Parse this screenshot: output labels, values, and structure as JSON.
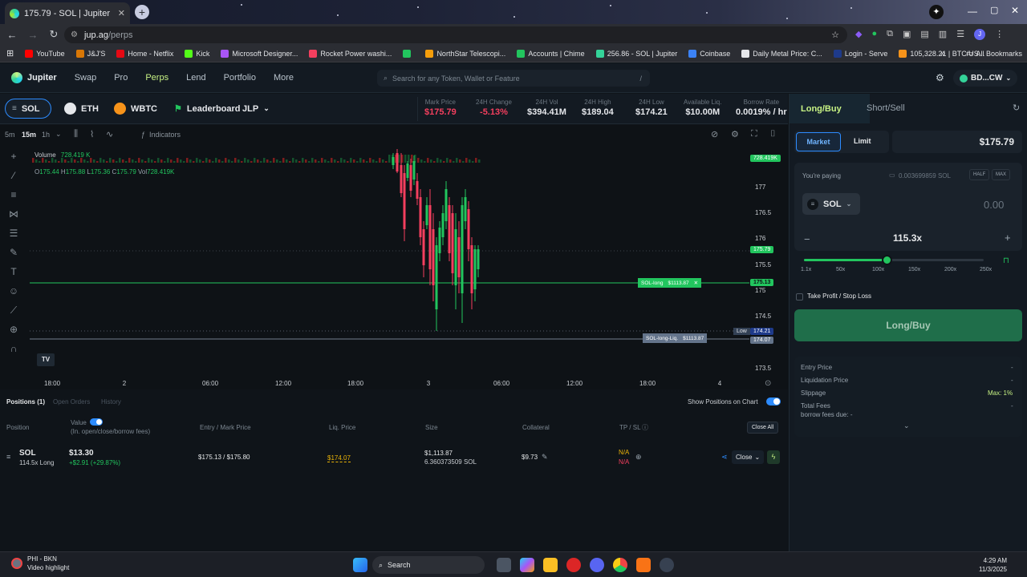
{
  "browser": {
    "tab_title": "175.79 - SOL | Jupiter",
    "url_domain": "jup.ag",
    "url_path": "/perps",
    "bookmarks": [
      {
        "label": "YouTube",
        "color": "#ff0000"
      },
      {
        "label": "J&J'S",
        "color": "#d97706"
      },
      {
        "label": "Home - Netflix",
        "color": "#e50914"
      },
      {
        "label": "Kick",
        "color": "#53fc18"
      },
      {
        "label": "Microsoft Designer...",
        "color": "#a855f7"
      },
      {
        "label": "Rocket Power washi...",
        "color": "#f43f5e"
      },
      {
        "label": "",
        "color": "#22c55e"
      },
      {
        "label": "NorthStar Telescopi...",
        "color": "#f59e0b"
      },
      {
        "label": "Accounts | Chime",
        "color": "#22c55e"
      },
      {
        "label": "256.86 - SOL | Jupiter",
        "color": "#34d399"
      },
      {
        "label": "Coinbase",
        "color": "#3b82f6"
      },
      {
        "label": "Daily Metal Price: C...",
        "color": "#e5e7eb"
      },
      {
        "label": "Login - Serve",
        "color": "#1e3a8a"
      },
      {
        "label": "105,328.21 | BTC/US...",
        "color": "#f7931a"
      }
    ],
    "all_bookmarks": "All Bookmarks"
  },
  "app": {
    "brand": "Jupiter",
    "nav": [
      "Swap",
      "Pro",
      "Perps",
      "Lend",
      "Portfolio",
      "More"
    ],
    "search_placeholder": "Search for any Token, Wallet or Feature",
    "search_shortcut": "/",
    "wallet": "BD...CW"
  },
  "market": {
    "tabs": [
      "SOL",
      "ETH",
      "WBTC"
    ],
    "leaderboard": "Leaderboard",
    "jlp": "JLP",
    "stats": [
      {
        "label": "Mark Price",
        "value": "$175.79",
        "color": "#f43f5e"
      },
      {
        "label": "24H Change",
        "value": "-5.13%",
        "color": "#f43f5e"
      },
      {
        "label": "24H Vol",
        "value": "$394.41M",
        "color": "#e5e7eb"
      },
      {
        "label": "24H High",
        "value": "$189.04",
        "color": "#e5e7eb"
      },
      {
        "label": "24H Low",
        "value": "$174.21",
        "color": "#e5e7eb"
      },
      {
        "label": "Available Liq.",
        "value": "$10.00M",
        "color": "#e5e7eb"
      },
      {
        "label": "Borrow Rate",
        "value": "0.0019% / hr",
        "color": "#e5e7eb"
      }
    ]
  },
  "chart": {
    "intervals": [
      "5m",
      "15m",
      "1h"
    ],
    "indicators": "Indicators",
    "volume_label": "Volume",
    "volume_value": "728.419 K",
    "ohlc": {
      "o": "175.44",
      "h": "175.88",
      "l": "175.36",
      "c": "175.79",
      "vol": "728.419K"
    },
    "price_ticks": [
      "177",
      "176.5",
      "176",
      "175.5",
      "175",
      "174.5",
      "174",
      "173.5"
    ],
    "time_ticks": [
      "18:00",
      "2",
      "06:00",
      "12:00",
      "18:00",
      "3",
      "06:00",
      "12:00",
      "18:00",
      "4"
    ],
    "tags": {
      "volume": "728.419K",
      "mark": "175.79",
      "entry": "175.13",
      "low_label": "Low",
      "low": "174.21",
      "liq": "174.07"
    },
    "sol_long_label": "SOL-long",
    "sol_long_value": "$1113.87",
    "liq_line_label": "SOL-long-Liq.",
    "liq_line_value": "$1113.87"
  },
  "positions": {
    "tabs": [
      "Positions (1)",
      "Open Orders",
      "History"
    ],
    "show_on_chart": "Show Positions on Chart",
    "headers": {
      "position": "Position",
      "value": "Value",
      "value_sub": "(In. open/close/borrow fees)",
      "entry_mark": "Entry / Mark Price",
      "liq": "Liq. Price",
      "size": "Size",
      "collateral": "Collateral",
      "tpsl": "TP / SL",
      "close_all": "Close All"
    },
    "row": {
      "symbol": "SOL",
      "leverage": "114.5x Long",
      "value": "$13.30",
      "pnl": "+$2.91 (+29.87%)",
      "entry_mark": "$175.13 / $175.80",
      "liq": "$174.07",
      "size_usd": "$1,113.87",
      "size_sol": "6.360373509 SOL",
      "collateral": "$9.73",
      "tp": "N/A",
      "sl": "N/A",
      "close": "Close"
    }
  },
  "trade": {
    "long_tab": "Long/Buy",
    "short_tab": "Short/Sell",
    "market": "Market",
    "limit": "Limit",
    "price": "$175.79",
    "paying_label": "You're paying",
    "balance": "0.003699859 SOL",
    "half": "HALF",
    "max": "MAX",
    "token": "SOL",
    "amount": "0.00",
    "leverage": "115.3x",
    "leverage_marks": [
      "1.1x",
      "50x",
      "100x",
      "150x",
      "200x",
      "250x"
    ],
    "leverage_fraction": 0.46,
    "tpsl": "Take Profit / Stop Loss",
    "submit": "Long/Buy",
    "entry_price": "Entry Price",
    "liq_price": "Liquidation Price",
    "slippage": "Slippage",
    "slippage_value": "Max: 1%",
    "total_fees": "Total Fees",
    "borrow_fees": "borrow fees due: -",
    "dash": "-"
  },
  "taskbar": {
    "notif_title": "PHI - BKN",
    "notif_sub": "Video highlight",
    "search": "Search",
    "time": "4:29 AM",
    "date": "11/3/2025"
  }
}
